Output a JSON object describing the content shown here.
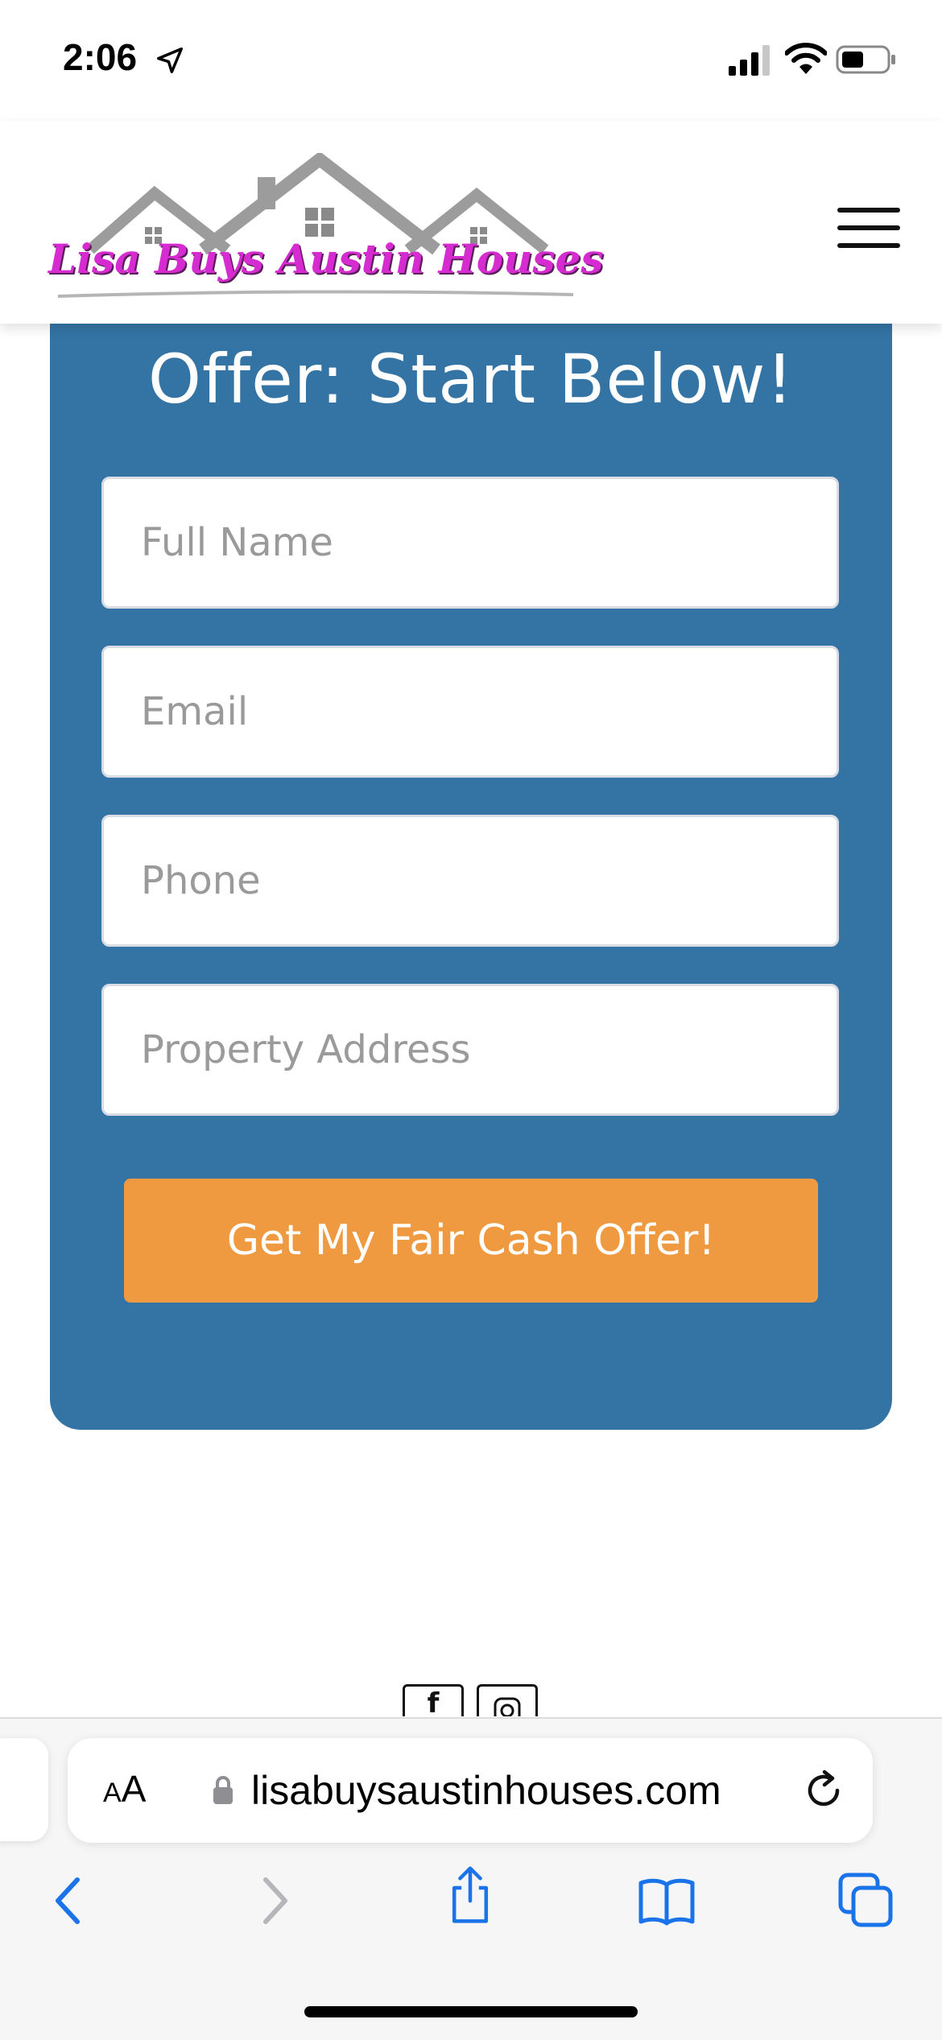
{
  "status_bar": {
    "time": "2:06",
    "icons": [
      "location-arrow-icon",
      "cellular-signal-icon",
      "wifi-icon",
      "battery-icon"
    ]
  },
  "header": {
    "logo_text": "Lisa Buys Austin Houses",
    "menu_icon": "hamburger-menu-icon"
  },
  "form": {
    "heading": "Offer: Start Below!",
    "fields": [
      {
        "placeholder": "Full Name",
        "value": ""
      },
      {
        "placeholder": "Email",
        "value": ""
      },
      {
        "placeholder": "Phone",
        "value": ""
      },
      {
        "placeholder": "Property Address",
        "value": ""
      }
    ],
    "submit_label": "Get My Fair Cash Offer!",
    "colors": {
      "card": "#3474a5",
      "button": "#ef9a40"
    }
  },
  "social": {
    "facebook_glyph": "f",
    "instagram_icon": "instagram-icon"
  },
  "browser": {
    "reader_small": "A",
    "reader_large": "A",
    "url": "lisabuysaustinhouses.com",
    "toolbar_icons": [
      "back-icon",
      "forward-icon",
      "share-icon",
      "bookmarks-icon",
      "tabs-icon"
    ],
    "accent": "#1a73e8"
  }
}
